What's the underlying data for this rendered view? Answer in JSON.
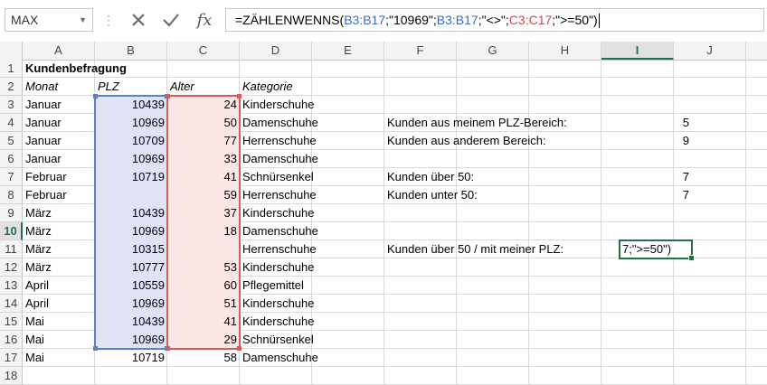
{
  "name_box": {
    "value": "MAX"
  },
  "formula_bar": {
    "cancel_icon": "close-x-icon",
    "enter_icon": "check-icon",
    "fx_label": "fx",
    "parts": [
      {
        "text": "=ZÄHLENWENNS(",
        "color": "black"
      },
      {
        "text": "B3:B17",
        "color": "blue"
      },
      {
        "text": ";\"10969\";",
        "color": "black"
      },
      {
        "text": "B3:B17",
        "color": "blue"
      },
      {
        "text": ";\"<>\";",
        "color": "black"
      },
      {
        "text": "C3:C17",
        "color": "red"
      },
      {
        "text": ";\">=50\")",
        "color": "black"
      }
    ]
  },
  "columns": [
    "A",
    "B",
    "C",
    "D",
    "E",
    "F",
    "G",
    "H",
    "I",
    "J"
  ],
  "active_column": "I",
  "rows": [
    "1",
    "2",
    "3",
    "4",
    "5",
    "6",
    "7",
    "8",
    "9",
    "10",
    "11",
    "12",
    "13",
    "14",
    "15",
    "16",
    "17",
    "18"
  ],
  "active_row": "10",
  "sheet": {
    "title": "Kundenbefragung",
    "headers": {
      "monat": "Monat",
      "plz": "PLZ",
      "alter": "Alter",
      "kategorie": "Kategorie"
    },
    "data": [
      {
        "monat": "Januar",
        "plz": "10439",
        "alter": "24",
        "kategorie": "Kinderschuhe"
      },
      {
        "monat": "Januar",
        "plz": "10969",
        "alter": "50",
        "kategorie": "Damenschuhe"
      },
      {
        "monat": "Januar",
        "plz": "10709",
        "alter": "77",
        "kategorie": "Herrenschuhe"
      },
      {
        "monat": "Januar",
        "plz": "10969",
        "alter": "33",
        "kategorie": "Damenschuhe"
      },
      {
        "monat": "Februar",
        "plz": "10719",
        "alter": "41",
        "kategorie": "Schnürsenkel"
      },
      {
        "monat": "Februar",
        "plz": "",
        "alter": "59",
        "kategorie": "Herrenschuhe"
      },
      {
        "monat": "März",
        "plz": "10439",
        "alter": "37",
        "kategorie": "Kinderschuhe"
      },
      {
        "monat": "März",
        "plz": "10969",
        "alter": "18",
        "kategorie": "Damenschuhe"
      },
      {
        "monat": "März",
        "plz": "10315",
        "alter": "",
        "kategorie": "Herrenschuhe"
      },
      {
        "monat": "März",
        "plz": "10777",
        "alter": "53",
        "kategorie": "Kinderschuhe"
      },
      {
        "monat": "April",
        "plz": "10559",
        "alter": "60",
        "kategorie": "Pflegemittel"
      },
      {
        "monat": "April",
        "plz": "10969",
        "alter": "51",
        "kategorie": "Kinderschuhe"
      },
      {
        "monat": "Mai",
        "plz": "10439",
        "alter": "41",
        "kategorie": "Kinderschuhe"
      },
      {
        "monat": "Mai",
        "plz": "10969",
        "alter": "29",
        "kategorie": "Schnürsenkel"
      },
      {
        "monat": "Mai",
        "plz": "10719",
        "alter": "58",
        "kategorie": "Damenschuhe"
      }
    ],
    "summary": [
      {
        "label": "Kunden aus meinem PLZ-Bereich:",
        "value": "5"
      },
      {
        "label": "Kunden aus anderem Bereich:",
        "value": "9"
      },
      {
        "label": "Kunden über 50:",
        "value": "7"
      },
      {
        "label": "Kunden unter 50:",
        "value": "7"
      },
      {
        "label": "Kunden über 50 / mit meiner PLZ:",
        "value": "7;\">=50\")"
      }
    ]
  },
  "colors": {
    "accent": "#217346",
    "range_blue": "#5b7ed0",
    "range_red": "#d65c5c"
  }
}
